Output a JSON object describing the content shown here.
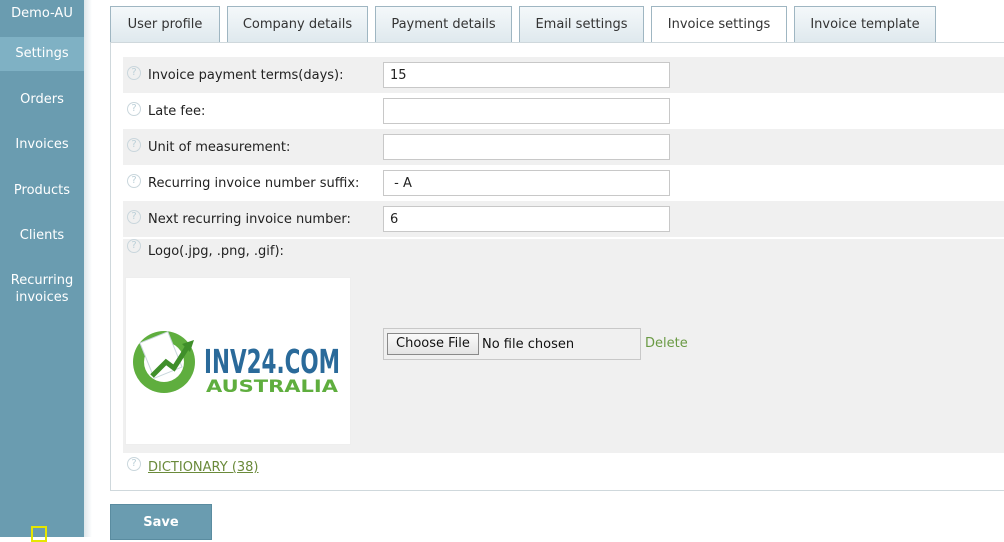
{
  "sidebar": {
    "brand": "Demo-AU",
    "items": [
      {
        "label": "Settings",
        "active": true
      },
      {
        "label": "Orders"
      },
      {
        "label": "Invoices"
      },
      {
        "label": "Products"
      },
      {
        "label": "Clients"
      },
      {
        "label": "Recurring invoices"
      }
    ]
  },
  "tabs": [
    {
      "label": "User profile"
    },
    {
      "label": "Company details"
    },
    {
      "label": "Payment details"
    },
    {
      "label": "Email settings"
    },
    {
      "label": "Invoice settings",
      "active": true
    },
    {
      "label": "Invoice template"
    }
  ],
  "form": {
    "help_icon": "question-circle-icon",
    "fields": [
      {
        "label": "Invoice payment terms(days):",
        "value": "15"
      },
      {
        "label": "Late fee:",
        "value": ""
      },
      {
        "label": "Unit of measurement:",
        "value": ""
      },
      {
        "label": "Recurring invoice number suffix:",
        "value": " - A"
      },
      {
        "label": "Next recurring invoice number:",
        "value": "6"
      }
    ],
    "logo": {
      "label": "Logo(.jpg, .png, .gif):",
      "brand_text": "INV24.COM",
      "brand_sub": "AUSTRALIA",
      "choose_file_label": "Choose File",
      "file_status": "No file chosen",
      "delete_label": "Delete"
    },
    "dictionary_link": "DICTIONARY (38)"
  },
  "save_label": "Save",
  "colors": {
    "accent": "#6a9cb0",
    "link": "#6a8a3a",
    "logo_green": "#5fae3e",
    "logo_blue": "#2a6a9a"
  }
}
